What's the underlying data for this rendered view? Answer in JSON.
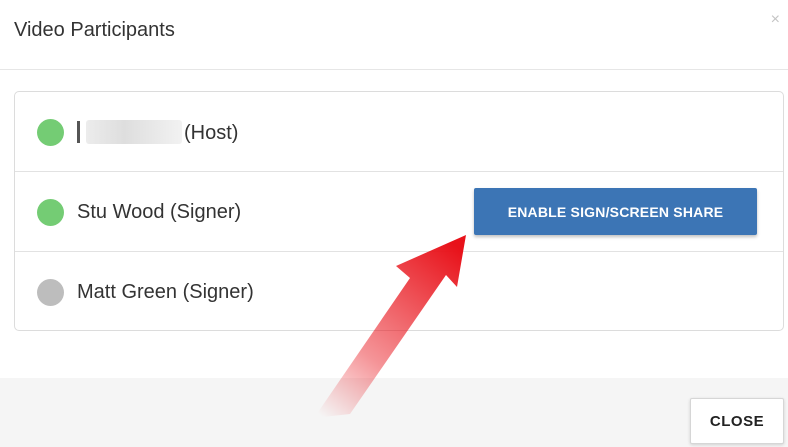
{
  "dialog": {
    "title": "Video Participants",
    "close_glyph": "×"
  },
  "participants": [
    {
      "name_suffix": "(Host)",
      "status": "online",
      "name_redacted": true
    },
    {
      "name": "Stu Wood (Signer)",
      "status": "online",
      "action_label": "ENABLE SIGN/SCREEN SHARE"
    },
    {
      "name": "Matt Green (Signer)",
      "status": "offline"
    }
  ],
  "footer": {
    "close_label": "CLOSE"
  },
  "colors": {
    "online": "#74cc74",
    "offline": "#bdbdbd",
    "primary_button": "#3c75b5",
    "annotation_arrow": "#e8121a"
  },
  "annotation": {
    "icon": "red-arrow-annotation",
    "points_to": "enable-sign-screen-share-button"
  }
}
